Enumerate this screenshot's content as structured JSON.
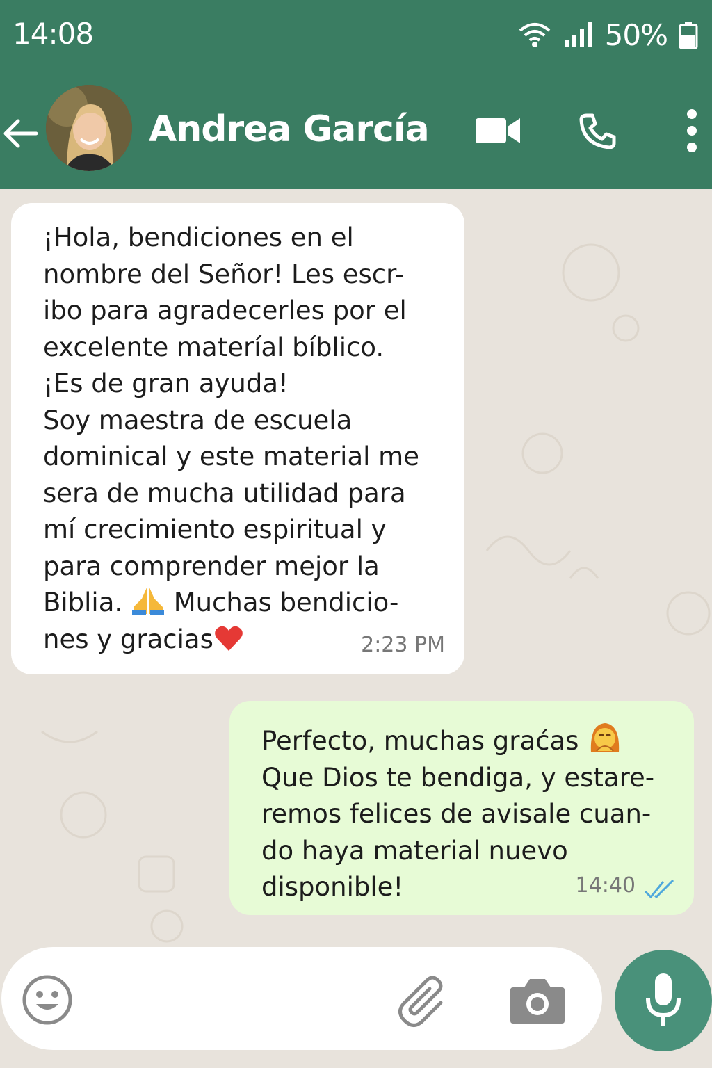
{
  "status_bar": {
    "time": "14:08",
    "battery_percent": "50%"
  },
  "header": {
    "back_icon": "arrow-left-icon",
    "contact_name": "Andrea García",
    "actions": [
      "video-call-icon",
      "phone-call-icon",
      "more-vertical-icon"
    ]
  },
  "messages": [
    {
      "direction": "incoming",
      "lines": [
        "¡Hola, bendiciones en el",
        "nombre del Señor! Les escr-",
        "ibo para agradecerles por el",
        "excelente materíal bíblico.",
        "¡Es de gran ayuda!",
        "Soy maestra de escuela",
        "dominical y este material me",
        "sera de mucha utilidad para",
        "mí crecimiento espiritual y",
        "para comprender mejor la",
        "Biblia.",
        "Muchas bendicio-",
        "nes y gracias"
      ],
      "time": "2:23 PM"
    },
    {
      "direction": "outgoing",
      "lines": [
        "Perfecto, muchas graćas",
        "Que Dios te bendiga, y estare-",
        "remos felices de avisale cuan-",
        "do haya material nuevo",
        "disponible!"
      ],
      "time": "14:40",
      "status": "read"
    }
  ],
  "input_bar": {
    "placeholder": "",
    "icons": [
      "emoji-icon",
      "paperclip-icon",
      "camera-icon",
      "microphone-icon"
    ]
  },
  "colors": {
    "header": "#3a7d62",
    "chat_bg": "#e8e3dc",
    "incoming_bubble": "#ffffff",
    "outgoing_bubble": "#e7fbd6",
    "mic_button": "#49917a",
    "read_ticks": "#4fa8dc"
  }
}
